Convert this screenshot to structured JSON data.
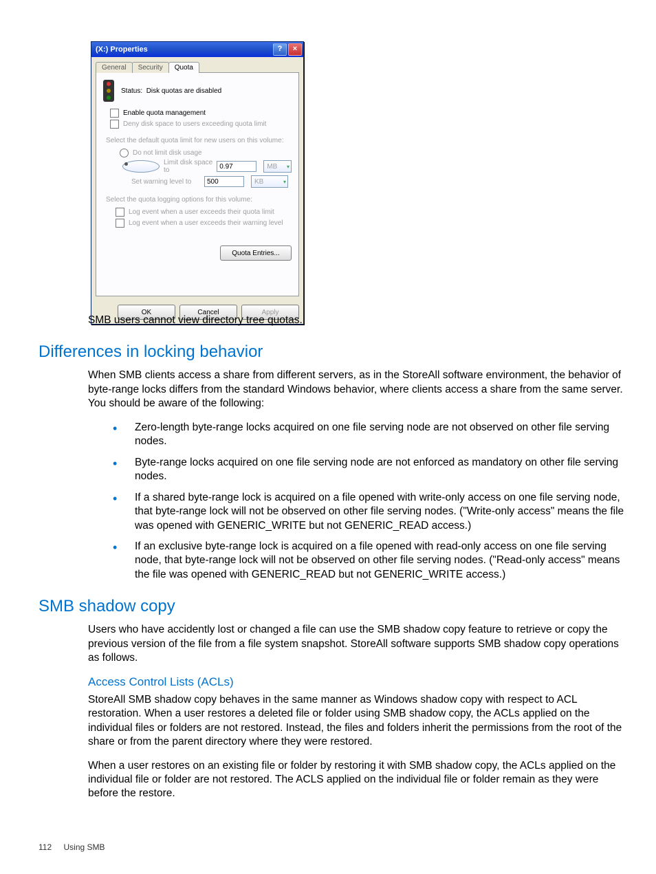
{
  "dialog": {
    "title": "(X:) Properties",
    "tabs": {
      "general": "General",
      "security": "Security",
      "quota": "Quota"
    },
    "status_label": "Status:",
    "status_value": "Disk quotas are disabled",
    "enable_quota": "Enable quota management",
    "deny_space": "Deny disk space to users exceeding quota limit",
    "select_default": "Select the default quota limit for new users on this volume:",
    "no_limit": "Do not limit disk usage",
    "limit_to": "Limit disk space to",
    "limit_value": "0.97",
    "limit_unit": "MB",
    "warn_to": "Set warning level to",
    "warn_value": "500",
    "warn_unit": "KB",
    "select_logging": "Select the quota logging options for this volume:",
    "log_quota": "Log event when a user exceeds their quota limit",
    "log_warn": "Log event when a user exceeds their warning level",
    "quota_entries": "Quota Entries...",
    "ok": "OK",
    "cancel": "Cancel",
    "apply": "Apply"
  },
  "body": {
    "smb_note": "SMB users cannot view directory tree quotas.",
    "h_diff": "Differences in locking behavior",
    "diff_para": "When SMB clients access a share from different servers, as in the StoreAll software environment, the behavior of byte-range locks differs from the standard Windows behavior, where clients access a share from the same server. You should be aware of the following:",
    "bullets": [
      "Zero-length byte-range locks acquired on one file serving node are not observed on other file serving nodes.",
      "Byte-range locks acquired on one file serving node are not enforced as mandatory on other file serving nodes.",
      "If a shared byte-range lock is acquired on a file opened with write-only access on one file serving node, that byte-range lock will not be observed on other file serving nodes. (\"Write-only access\" means the file was opened with GENERIC_WRITE but not GENERIC_READ access.)",
      "If an exclusive byte-range lock is acquired on a file opened with read-only access on one file serving node, that byte-range lock will not be observed on other file serving nodes. (\"Read-only access\" means the file was opened with GENERIC_READ but not GENERIC_WRITE access.)"
    ],
    "h_shadow": "SMB shadow copy",
    "shadow_para": "Users who have accidently lost or changed a file can use the SMB shadow copy feature to retrieve or copy the previous version of the file from a file system snapshot. StoreAll software supports SMB shadow copy operations as follows.",
    "h_acl": "Access Control Lists (ACLs)",
    "acl_para1": "StoreAll SMB shadow copy behaves in the same manner as Windows shadow copy with respect to ACL restoration. When a user restores a deleted file or folder using SMB shadow copy, the ACLs applied on the individual files or folders are not restored. Instead, the files and folders inherit the permissions from the root of the share or from the parent directory where they were restored.",
    "acl_para2": "When a user restores on an existing file or folder by restoring it with SMB shadow copy, the ACLs applied on the individual file or folder are not restored. The ACLS applied on the individual file or folder remain as they were before the restore."
  },
  "footer": {
    "page": "112",
    "section": "Using SMB"
  }
}
